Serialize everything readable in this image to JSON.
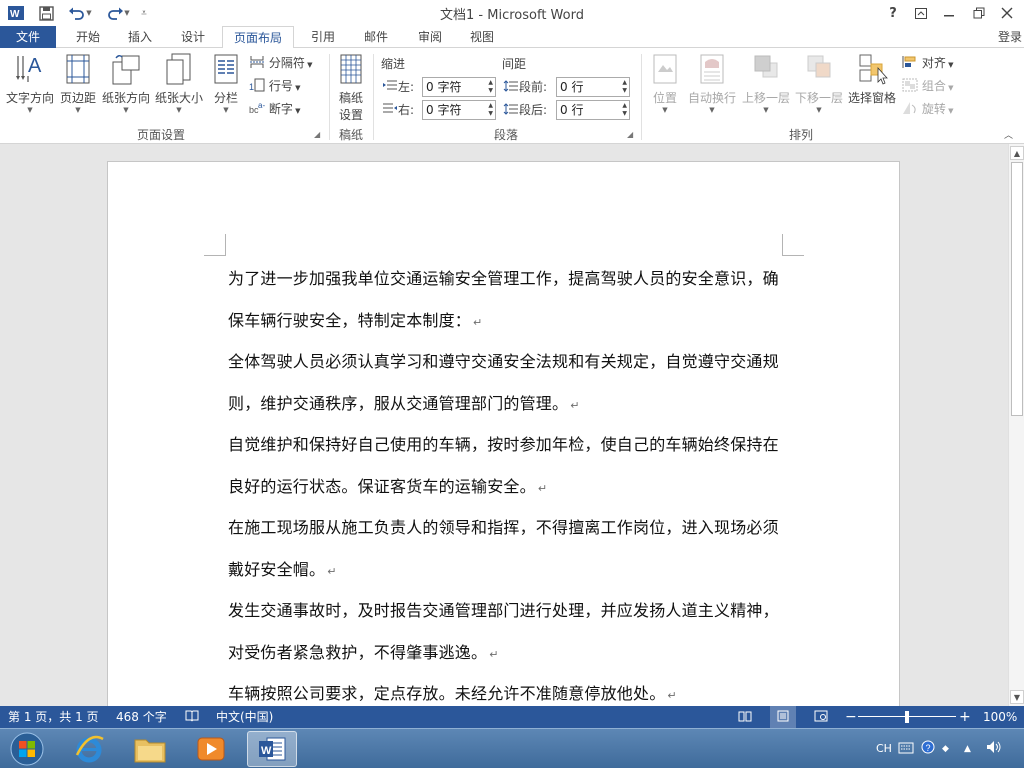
{
  "window": {
    "title": "文档1 - Microsoft Word",
    "help": "?",
    "login": "登录"
  },
  "tabs": [
    {
      "label": "文件"
    },
    {
      "label": "开始"
    },
    {
      "label": "插入"
    },
    {
      "label": "设计"
    },
    {
      "label": "页面布局"
    },
    {
      "label": "引用"
    },
    {
      "label": "邮件"
    },
    {
      "label": "审阅"
    },
    {
      "label": "视图"
    }
  ],
  "ribbon": {
    "page_setup": {
      "label": "页面设置",
      "text_direction": "文字方向",
      "margins": "页边距",
      "orientation": "纸张方向",
      "size": "纸张大小",
      "columns": "分栏",
      "breaks": "分隔符",
      "line_numbers": "行号",
      "hyphenation": "断字"
    },
    "draft": {
      "label": "稿纸",
      "button_line1": "稿纸",
      "button_line2": "设置"
    },
    "paragraph": {
      "label": "段落",
      "indent_title": "缩进",
      "spacing_title": "间距",
      "left_label": "左:",
      "right_label": "右:",
      "before_label": "段前:",
      "after_label": "段后:",
      "left_value": "0 字符",
      "right_value": "0 字符",
      "before_value": "0 行",
      "after_value": "0 行"
    },
    "arrange": {
      "label": "排列",
      "position": "位置",
      "wrap_text": "自动换行",
      "bring_forward": "上移一层",
      "send_backward": "下移一层",
      "selection_pane": "选择窗格",
      "align": "对齐",
      "group": "组合",
      "rotate": "旋转"
    }
  },
  "document": {
    "paragraphs": [
      "为了进一步加强我单位交通运输安全管理工作，提高驾驶人员的安全意识，确保车辆行驶安全，特制定本制度：",
      "全体驾驶人员必须认真学习和遵守交通安全法规和有关规定，自觉遵守交通规则，维护交通秩序，服从交通管理部门的管理。",
      "自觉维护和保持好自己使用的车辆，按时参加年检，使自己的车辆始终保持在良好的运行状态。保证客货车的运输安全。",
      "在施工现场服从施工负责人的领导和指挥，不得擅离工作岗位，进入现场必须戴好安全帽。",
      "发生交通事故时，及时报告交通管理部门进行处理，并应发扬人道主义精神，对受伤者紧急救护，不得肇事逃逸。",
      "车辆按照公司要求，定点存放。未经允许不准随意停放他处。"
    ],
    "paragraph_mark": "↵"
  },
  "statusbar": {
    "page_info": "第 1 页，共 1 页",
    "word_count": "468 个字",
    "language": "中文(中国)",
    "zoom": "100%",
    "zoom_level": 0.5
  },
  "taskbar": {
    "ime": "CH"
  },
  "colors": {
    "word_blue": "#2b579a",
    "taskbar": "#3f6b9b"
  }
}
